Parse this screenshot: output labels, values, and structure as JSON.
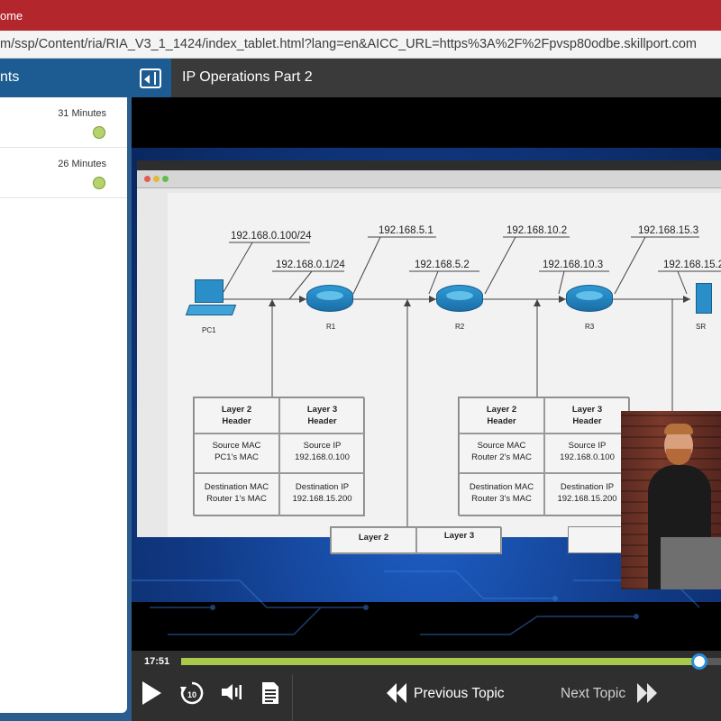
{
  "browser": {
    "tab_title": "ome",
    "url": "m/ssp/Content/ria/RIA_V3_1_1424/index_tablet.html?lang=en&AICC_URL=https%3A%2F%2Fpvsp80odbe.skillport.com"
  },
  "sidebar": {
    "header_title": "nts",
    "lessons": [
      {
        "duration": "31 Minutes",
        "status": "complete"
      },
      {
        "duration": "26 Minutes",
        "status": "complete"
      }
    ]
  },
  "topic": {
    "title": "IP Operations Part 2"
  },
  "slide": {
    "ip_labels": {
      "pc1_ip": "192.168.0.100/24",
      "r1_left_ip": "192.168.0.1/24",
      "r1_right_ip": "192.168.5.1",
      "r2_left_ip": "192.168.5.2",
      "r2_right_ip": "192.168.10.2",
      "r3_left_ip": "192.168.10.3",
      "r3_right_ip": "192.168.15.3",
      "srv_ip": "192.168.15.2"
    },
    "devices": {
      "pc": "PC1",
      "r1": "R1",
      "r2": "R2",
      "r3": "R3",
      "srv": "SR"
    },
    "table1": {
      "l2_header": "Layer 2\nHeader",
      "l3_header": "Layer 3\nHeader",
      "src_mac": "Source MAC\nPC1's MAC",
      "src_ip": "Source IP\n192.168.0.100",
      "dst_mac": "Destination MAC\nRouter 1's MAC",
      "dst_ip": "Destination IP\n192.168.15.200"
    },
    "table2": {
      "l2_header": "Layer 2\nHeader",
      "l3_header": "Layer 3\nHeader",
      "src_mac": "Source MAC\nRouter 2's MAC",
      "src_ip": "Source IP\n192.168.0.100",
      "dst_mac": "Destination MAC\nRouter 3's MAC",
      "dst_ip": "Destination IP\n192.168.15.200"
    },
    "table3": {
      "l2": "Layer 2",
      "l3": "Layer 3"
    }
  },
  "player": {
    "time": "17:51",
    "progress": 0.96,
    "replay_seconds": "10",
    "prev_label": "Previous Topic",
    "next_label": "Next Topic"
  },
  "colors": {
    "accent_blue": "#1d5c93",
    "progress_fill": "#a9c84c",
    "status_complete": "#b6d26b",
    "titlebar": "#b3262c"
  }
}
